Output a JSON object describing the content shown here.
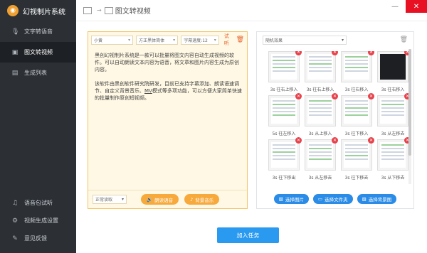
{
  "app": {
    "title": "幻视制片系统",
    "logo_glyph": "◉"
  },
  "sidebar": {
    "items": [
      {
        "label": "文字转语音",
        "icon": "microphone-icon"
      },
      {
        "label": "图文转视频",
        "icon": "video-icon"
      },
      {
        "label": "生成列表",
        "icon": "list-icon"
      }
    ],
    "bottom": [
      {
        "label": "语音包试听",
        "icon": "headphone-icon"
      },
      {
        "label": "视频生成设置",
        "icon": "gear-icon"
      },
      {
        "label": "意见反馈",
        "icon": "feedback-icon"
      }
    ]
  },
  "breadcrumb": {
    "current": "图文转视频"
  },
  "editor": {
    "size_select": "小黄",
    "font_select": "方正黑体简体",
    "speed_select": "字幕速度:12",
    "try_label": "试听",
    "paragraph1": "黑创幻视制片系统是一款可以批量将图文内容自动生成视频的软件。可以自动朗读文本内容为语音，将文章和图片内容生成为原创内容。",
    "paragraph2_a": "该软件由黑创软件研究院研发，目前已支持字幕添加、朗读语速调节、自定义背景音乐、",
    "paragraph2_mv": "MV",
    "paragraph2_b": "模式等多项功能，可以方便大家简单快速的批量制作原创短视频。",
    "mode_select": "正常读取",
    "btn_read": "朗读语音",
    "btn_music": "背景音乐"
  },
  "images": {
    "mode_select": "随机效果",
    "captions": [
      "3s 往右上移入",
      "3s 往右上移入",
      "3s 往右移入",
      "3s 往右移入",
      "5s 往左移入",
      "3s 从上移入",
      "3s 往下移入",
      "3s 从左移去",
      "3s 往下移出",
      "3s 从左移去",
      "3s 往下移去",
      "3s 从下移去"
    ],
    "btn_select_image": "选择图片",
    "btn_select_folder": "选择文件夹",
    "btn_select_bg": "选择背景图"
  },
  "actions": {
    "add_task": "加入任务"
  },
  "window": {
    "minimize": "—",
    "close": "✕"
  }
}
